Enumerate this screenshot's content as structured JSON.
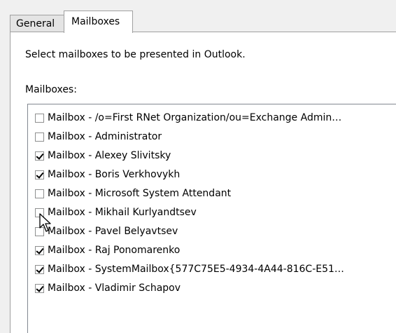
{
  "tabs": [
    {
      "label": "General"
    },
    {
      "label": "Mailboxes"
    }
  ],
  "panel": {
    "instruction": "Select mailboxes to be presented in Outlook.",
    "list_label": "Mailboxes:"
  },
  "mailboxes": [
    {
      "label": "Mailbox - /o=First RNet Organization/ou=Exchange Admin…",
      "checked": false
    },
    {
      "label": "Mailbox - Administrator",
      "checked": false
    },
    {
      "label": "Mailbox - Alexey Slivitsky",
      "checked": true
    },
    {
      "label": "Mailbox - Boris Verkhovykh",
      "checked": true
    },
    {
      "label": "Mailbox - Microsoft System Attendant",
      "checked": false
    },
    {
      "label": "Mailbox - Mikhail Kurlyandtsev",
      "checked": false
    },
    {
      "label": "Mailbox - Pavel Belyavtsev",
      "checked": false
    },
    {
      "label": "Mailbox - Raj Ponomarenko",
      "checked": true
    },
    {
      "label": "Mailbox - SystemMailbox{577C75E5-4934-4A44-816C-E51…",
      "checked": true
    },
    {
      "label": "Mailbox - Vladimir Schapov",
      "checked": true
    }
  ],
  "icons": {
    "cursor": "mouse-pointer-icon",
    "checkbox": "checkbox-icon"
  }
}
